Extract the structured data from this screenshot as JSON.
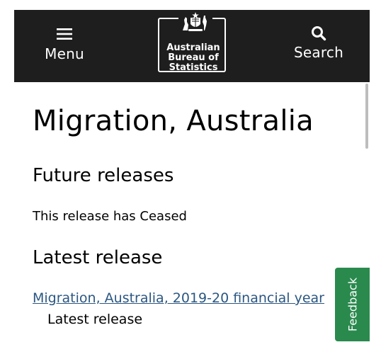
{
  "header": {
    "menu_label": "Menu",
    "menu_icon": "hamburger-menu-icon",
    "search_label": "Search",
    "search_icon": "search-icon",
    "logo": {
      "emblem": "australian-coat-of-arms-crest",
      "line1": "Australian",
      "line2": "Bureau of",
      "line3": "Statistics"
    },
    "background_color": "#1e1e1e"
  },
  "main": {
    "title": "Migration, Australia",
    "future_releases": {
      "heading": "Future releases",
      "text": "This release has Ceased"
    },
    "latest_release": {
      "heading": "Latest release",
      "link_text": "Migration, Australia, 2019-20 financial year",
      "caption": "Latest release"
    },
    "link_color": "#2b5782"
  },
  "feedback": {
    "label": "Feedback",
    "color": "#2a8a4e"
  }
}
